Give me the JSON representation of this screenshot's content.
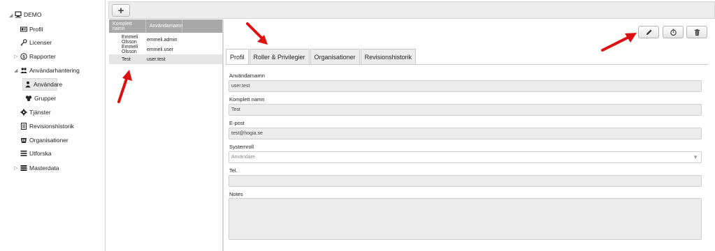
{
  "sidebar": {
    "root": {
      "label": "DEMO",
      "toggle": "◢"
    },
    "items": [
      {
        "label": "Profil",
        "icon": "id-card-icon"
      },
      {
        "label": "Licenser",
        "icon": "key-icon"
      },
      {
        "label": "Rapporter",
        "icon": "report-icon",
        "toggle": "▷"
      },
      {
        "label": "Användarhantering",
        "icon": "users-icon",
        "toggle": "◢"
      },
      {
        "label": "Användare",
        "icon": "user-icon",
        "selected": true
      },
      {
        "label": "Grupper",
        "icon": "group-icon"
      },
      {
        "label": "Tjänster",
        "icon": "gear-icon"
      },
      {
        "label": "Revisionshistorik",
        "icon": "document-icon"
      },
      {
        "label": "Organisationer",
        "icon": "organization-icon"
      },
      {
        "label": "Utforska",
        "icon": "list-icon"
      },
      {
        "label": "Masterdata",
        "icon": "database-icon",
        "toggle": "▷"
      }
    ]
  },
  "toolbar": {
    "add_label": "+"
  },
  "user_list": {
    "columns": [
      "Komplett namn",
      "Användarnamn"
    ],
    "rows": [
      {
        "full_name": "Emmeli Olsson",
        "username": "emmeli.admin"
      },
      {
        "full_name": "Emmeli Olsson",
        "username": "emmeli.user"
      },
      {
        "full_name": "Test",
        "username": "user.test",
        "selected": true
      }
    ]
  },
  "detail": {
    "actions": [
      "edit-icon",
      "history-icon",
      "trash-icon"
    ],
    "tabs": [
      "Profil",
      "Roller & Privilegier",
      "Organisationer",
      "Revisionshistorik"
    ],
    "active_tab": "Profil",
    "fields": {
      "username": {
        "label": "Användarnamn",
        "value": "user.test"
      },
      "full_name": {
        "label": "Komplett namn",
        "value": "Test"
      },
      "email": {
        "label": "E-post",
        "value": "test@hogia.se"
      },
      "system_role": {
        "label": "Systemroll",
        "value": "Användare"
      },
      "phone": {
        "label": "Tel.",
        "value": ""
      },
      "notes": {
        "label": "Notes",
        "value": ""
      }
    }
  },
  "colors": {
    "arrow": "#dd1111",
    "list_header": "#a9a9a9",
    "selected_row": "#e5e5e5"
  }
}
